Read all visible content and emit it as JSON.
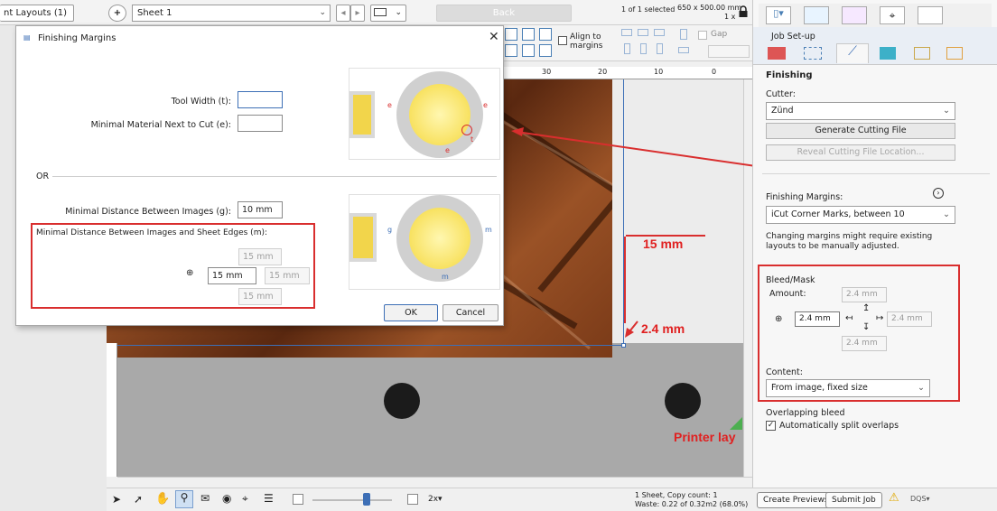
{
  "toolbar": {
    "layouts_tab": "nt Layouts (1)",
    "sheet_name": "Sheet 1",
    "back_label": "Back",
    "selection_count": "1 of 1 selected",
    "sheet_size": "650 x 500.00 mm",
    "sheet_sub": "1 x",
    "align_to_margins": "Align to margins",
    "gap_label": "Gap"
  },
  "ruler": {
    "ticks": [
      "30",
      "20",
      "10",
      "0"
    ]
  },
  "dialog": {
    "title": "Finishing Margins",
    "tool_width_label": "Tool Width (t):",
    "tool_width_value": "",
    "minimal_material_label": "Minimal Material Next to Cut (e):",
    "minimal_material_value": "",
    "or_label": "OR",
    "min_distance_label": "Minimal Distance Between Images (g):",
    "min_distance_value": "10 mm",
    "sheet_edges_label": "Minimal Distance Between Images and Sheet Edges (m):",
    "edge_top": "15 mm",
    "edge_left": "15 mm",
    "edge_right": "15 mm",
    "edge_bottom": "15 mm",
    "ok_label": "OK",
    "cancel_label": "Cancel",
    "diagram_e": "e",
    "diagram_t": "t",
    "diagram_g": "g",
    "diagram_m": "m"
  },
  "annotations": {
    "margin_15": "15 mm",
    "bleed_24": "2.4 mm",
    "printer_lay": "Printer lay"
  },
  "right_panel": {
    "tab_title": "Job Set-up",
    "section_title": "Finishing",
    "cutter_label": "Cutter:",
    "cutter_value": "Zünd",
    "generate_button": "Generate Cutting File",
    "reveal_button": "Reveal Cutting File Location...",
    "finishing_margins_label": "Finishing Margins:",
    "finishing_margins_value": "iCut Corner Marks, between 10",
    "note": "Changing margins might require existing layouts to be manually adjusted.",
    "bleed_title": "Bleed/Mask",
    "amount_label": "Amount:",
    "amount_top": "2.4 mm",
    "amount_left": "2.4 mm",
    "amount_right": "2.4 mm",
    "amount_bottom": "2.4 mm",
    "content_label": "Content:",
    "content_value": "From image, fixed size",
    "overlap_label": "Overlapping bleed",
    "auto_split_label": "Automatically split overlaps"
  },
  "bottom": {
    "zoom": "2x▾",
    "status_line1": "1 Sheet, Copy count: 1",
    "status_line2": "Waste: 0.22 of 0.32m2 (68.0%)",
    "create_previews": "Create Previews",
    "submit_job": "Submit Job",
    "dqs": "DQS▾"
  },
  "colors": {
    "accent_red": "#d92e2e",
    "selection_blue": "#3d6fb6"
  }
}
